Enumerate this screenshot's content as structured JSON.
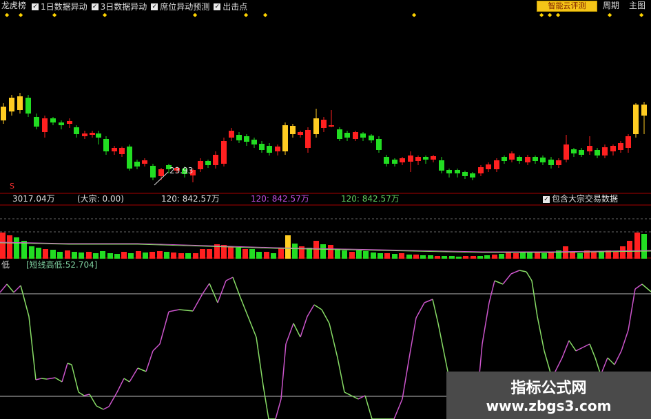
{
  "toolbar": {
    "title": "龙虎榜",
    "checks": [
      {
        "label": "1日数据异动",
        "checked": true
      },
      {
        "label": "3日数据异动",
        "checked": true
      },
      {
        "label": "席位异动预测",
        "checked": true
      },
      {
        "label": "出击点",
        "checked": true
      }
    ],
    "ai_button": "智能云评测",
    "period": "周期",
    "main": "主图"
  },
  "price_annotation": "23.93",
  "vol_info": {
    "vol": "3017.04万",
    "big": "(大宗: 0.00)",
    "ma1": "120: 842.57万",
    "ma2": "120: 842.57万",
    "ma3": "120: 842.57万",
    "include_label": "包含大宗交易数据",
    "include_checked": true
  },
  "indicator": {
    "label": "低",
    "legend": "[短线高低:52.704]"
  },
  "watermark": {
    "line1": "指标公式网",
    "line2": "www.zbgs3.com"
  },
  "colors": {
    "up": "#ff2020",
    "down": "#22dd22",
    "yellow": "#ffcc22",
    "osc_green": "#88dd66",
    "osc_purple": "#cc55cc"
  }
}
